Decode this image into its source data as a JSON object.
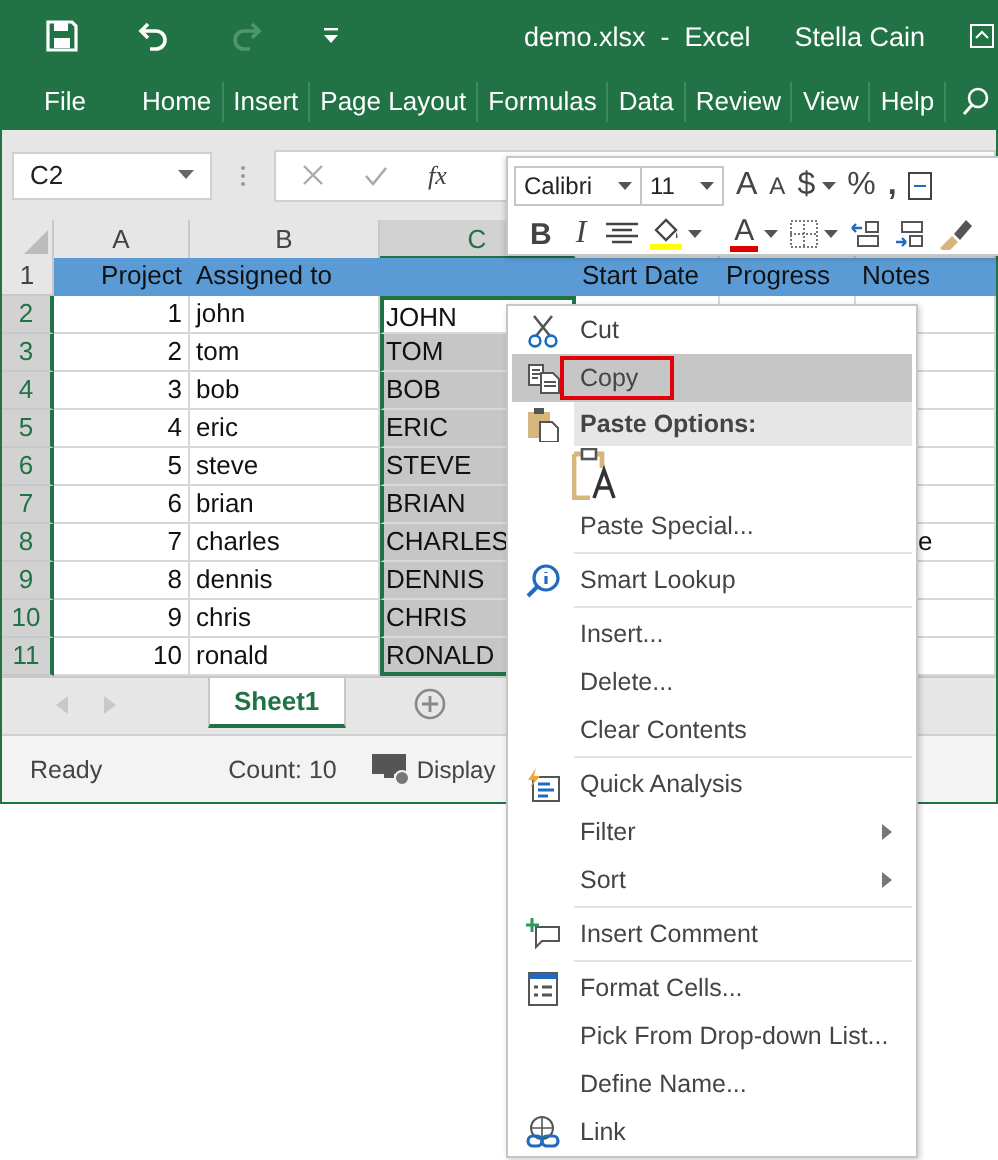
{
  "title_bar": {
    "title": "demo.xlsx  -  Excel",
    "user": "Stella Cain",
    "quick_access": [
      {
        "kind": "save",
        "disabled": false
      },
      {
        "kind": "undo",
        "disabled": false
      },
      {
        "kind": "redo",
        "disabled": true
      },
      {
        "kind": "customize",
        "disabled": false
      }
    ]
  },
  "ribbon_tabs": [
    "File",
    "Home",
    "Insert",
    "Page Layout",
    "Formulas",
    "Data",
    "Review",
    "View",
    "Help"
  ],
  "formula_bar": {
    "name_box": "C2",
    "function_label": "fx"
  },
  "mini_toolbar": {
    "font": "Calibri",
    "size": "11",
    "row1": [
      {
        "kind": "grow",
        "label": "A"
      },
      {
        "kind": "shrink",
        "label": "A"
      },
      {
        "kind": "currency",
        "label": "$"
      },
      {
        "kind": "percent",
        "label": "%"
      },
      {
        "kind": "comma",
        "label": ","
      }
    ],
    "row2": [
      {
        "kind": "bold",
        "label": "B"
      },
      {
        "kind": "italic",
        "label": "I"
      },
      {
        "kind": "align"
      },
      {
        "kind": "fill"
      },
      {
        "kind": "font_color",
        "label": "A"
      },
      {
        "kind": "borders"
      },
      {
        "kind": "inc_decimal"
      },
      {
        "kind": "dec_decimal"
      },
      {
        "kind": "painter"
      }
    ]
  },
  "columns": [
    {
      "label": "A",
      "selected": false
    },
    {
      "label": "B",
      "selected": false
    },
    {
      "label": "C",
      "selected": true
    }
  ],
  "rows": [
    {
      "number": "1",
      "kind": "heading",
      "selected": false,
      "active": false,
      "cells": {
        "a": "Project",
        "b": "Assigned to",
        "d": "Start Date",
        "e": "Progress",
        "f": "Notes"
      }
    },
    {
      "number": "2",
      "kind": "data",
      "selected": true,
      "active": true,
      "cells": {
        "a": "1",
        "b": "john",
        "c": "JOHN"
      }
    },
    {
      "number": "3",
      "kind": "data",
      "selected": true,
      "active": false,
      "cells": {
        "a": "2",
        "b": "tom",
        "c": "TOM"
      }
    },
    {
      "number": "4",
      "kind": "data",
      "selected": true,
      "active": false,
      "cells": {
        "a": "3",
        "b": "bob",
        "c": "BOB"
      }
    },
    {
      "number": "5",
      "kind": "data",
      "selected": true,
      "active": false,
      "cells": {
        "a": "4",
        "b": "eric",
        "c": "ERIC"
      }
    },
    {
      "number": "6",
      "kind": "data",
      "selected": true,
      "active": false,
      "cells": {
        "a": "5",
        "b": "steve",
        "c": "STEVE"
      }
    },
    {
      "number": "7",
      "kind": "data",
      "selected": true,
      "active": false,
      "cells": {
        "a": "6",
        "b": "brian",
        "c": "BRIAN"
      }
    },
    {
      "number": "8",
      "kind": "data",
      "selected": true,
      "active": false,
      "cells": {
        "a": "7",
        "b": "charles",
        "c": "CHARLES",
        "f": "e"
      }
    },
    {
      "number": "9",
      "kind": "data",
      "selected": true,
      "active": false,
      "cells": {
        "a": "8",
        "b": "dennis",
        "c": "DENNIS"
      }
    },
    {
      "number": "10",
      "kind": "data",
      "selected": true,
      "active": false,
      "cells": {
        "a": "9",
        "b": "chris",
        "c": "CHRIS"
      }
    },
    {
      "number": "11",
      "kind": "data",
      "selected": true,
      "active": false,
      "cells": {
        "a": "10",
        "b": "ronald",
        "c": "RONALD"
      }
    }
  ],
  "sheet_tabs": [
    {
      "label": "Sheet1",
      "selected": true
    }
  ],
  "status_bar": {
    "status": "Ready",
    "count": "Count: 10",
    "display": "Display"
  },
  "context_menu": [
    {
      "kind": "cut",
      "label": "Cut",
      "selected": false,
      "outlined": false,
      "submenu": false
    },
    {
      "kind": "copy",
      "label": "Copy",
      "selected": true,
      "outlined": true,
      "submenu": false
    },
    {
      "kind": "header",
      "label": "Paste Options:"
    },
    {
      "kind": "paste"
    },
    {
      "kind": "plain",
      "label": "Paste Special...",
      "selected": false,
      "outlined": false,
      "submenu": false
    },
    {
      "kind": "separator"
    },
    {
      "kind": "lookup",
      "label": "Smart Lookup",
      "selected": false,
      "outlined": false,
      "submenu": false
    },
    {
      "kind": "separator"
    },
    {
      "kind": "plain",
      "label": "Insert...",
      "selected": false,
      "outlined": false,
      "submenu": false
    },
    {
      "kind": "plain",
      "label": "Delete...",
      "selected": false,
      "outlined": false,
      "submenu": false
    },
    {
      "kind": "plain",
      "label": "Clear Contents",
      "selected": false,
      "outlined": false,
      "submenu": false
    },
    {
      "kind": "separator"
    },
    {
      "kind": "analysis",
      "label": "Quick Analysis",
      "selected": false,
      "outlined": false,
      "submenu": false
    },
    {
      "kind": "plain",
      "label": "Filter",
      "selected": false,
      "outlined": false,
      "submenu": true
    },
    {
      "kind": "plain",
      "label": "Sort",
      "selected": false,
      "outlined": false,
      "submenu": true
    },
    {
      "kind": "separator"
    },
    {
      "kind": "comment",
      "label": "Insert Comment",
      "selected": false,
      "outlined": false,
      "submenu": false
    },
    {
      "kind": "separator"
    },
    {
      "kind": "format",
      "label": "Format Cells...",
      "selected": false,
      "outlined": false,
      "submenu": false
    },
    {
      "kind": "plain",
      "label": "Pick From Drop-down List...",
      "selected": false,
      "outlined": false,
      "submenu": false
    },
    {
      "kind": "plain",
      "label": "Define Name...",
      "selected": false,
      "outlined": false,
      "submenu": false
    },
    {
      "kind": "link",
      "label": "Link",
      "selected": false,
      "outlined": false,
      "submenu": false
    }
  ]
}
